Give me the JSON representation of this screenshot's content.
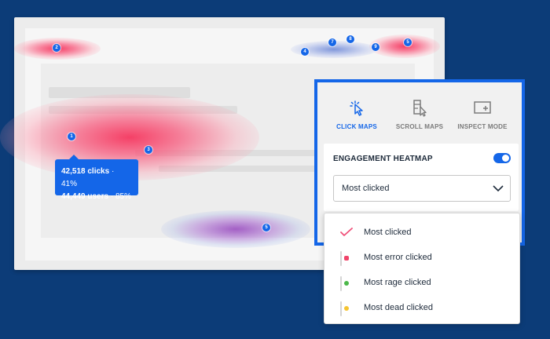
{
  "heatmap_page": {
    "markers": [
      "1",
      "2",
      "3",
      "4",
      "5",
      "6",
      "7",
      "8",
      "9"
    ],
    "tooltip": {
      "clicks": "42,518 clicks",
      "clicks_pct": "· 41%",
      "users": "44,449 users",
      "users_pct": "· 85%"
    }
  },
  "panel": {
    "modes": [
      {
        "label": "CLICK MAPS",
        "icon": "cursor-click-icon",
        "active": true
      },
      {
        "label": "SCROLL MAPS",
        "icon": "scroll-page-icon",
        "active": false
      },
      {
        "label": "INSPECT MODE",
        "icon": "inspect-window-icon",
        "active": false
      }
    ],
    "engagement": {
      "title": "ENGAGEMENT HEATMAP",
      "toggle_on": true,
      "selected": "Most clicked"
    }
  },
  "dropdown": {
    "options": [
      {
        "label": "Most clicked",
        "icon": "checkmark-icon"
      },
      {
        "label": "Most error clicked",
        "icon": "error-window-icon"
      },
      {
        "label": "Most rage clicked",
        "icon": "rage-window-icon"
      },
      {
        "label": "Most dead clicked",
        "icon": "dead-window-icon"
      }
    ]
  },
  "colors": {
    "background": "#0c3c78",
    "accent": "#1466e8",
    "heat_red": "#f5375f",
    "heat_purple": "#9646be"
  }
}
